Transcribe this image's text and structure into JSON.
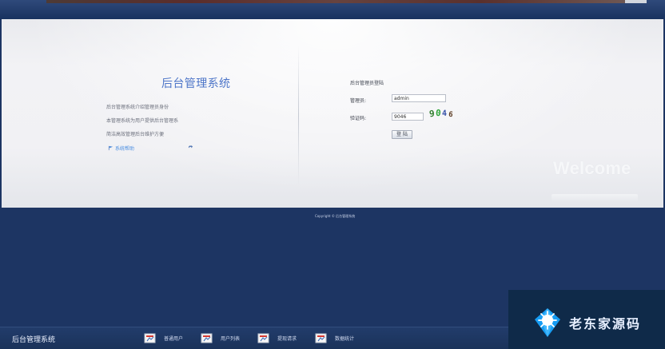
{
  "brand": {
    "system_title": "后台管理系统",
    "intro_lines": [
      "后台管理系统介绍管理员身份",
      "本管理系统为用户提供后台管理系",
      "简洁高效管理后台维护方便"
    ],
    "help_link": "系统帮助"
  },
  "login": {
    "title": "后台管理员登陆",
    "username_label": "管理员:",
    "username_value": "admin",
    "captcha_label": "验证码:",
    "captcha_value": "9046",
    "captcha_chars": [
      "9",
      "0",
      "4",
      "6"
    ],
    "submit_label": "登 陆"
  },
  "decorations": {
    "welcome_text": "Welcome",
    "copyright_text": "Copyright © 后台管理系统"
  },
  "taskbar": {
    "app_title": "后台管理系统",
    "items": [
      {
        "label": "普通用户",
        "icon": "document-icon"
      },
      {
        "label": "用户列表",
        "icon": "document-icon"
      },
      {
        "label": "提现请求",
        "icon": "document-icon"
      },
      {
        "label": "数据统计",
        "icon": "document-icon"
      }
    ]
  },
  "watermark": {
    "text": "老东家源码",
    "icon": "diamond-icon"
  },
  "colors": {
    "background": "#1d3563",
    "panel": "#f1f1f4",
    "title_blue": "#4d75c8",
    "link_blue": "#4c8fe1",
    "taskbar": "#223c6b",
    "watermark_blue": "#159bf2"
  }
}
